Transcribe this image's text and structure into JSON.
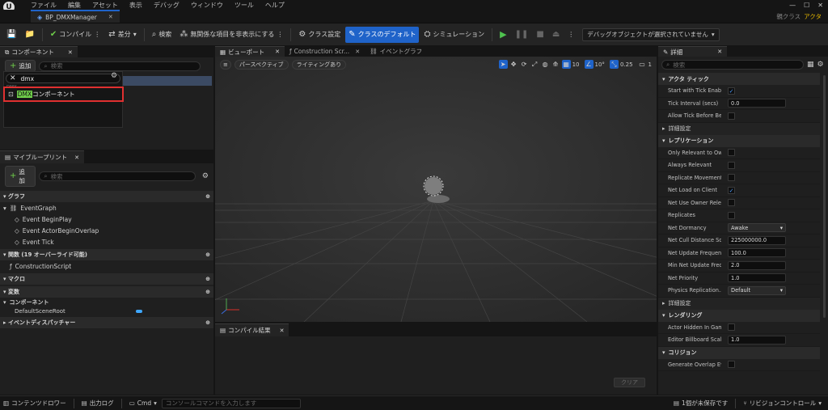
{
  "menubar": {
    "items": [
      "ファイル",
      "編集",
      "アセット",
      "表示",
      "デバッグ",
      "ウィンドウ",
      "ツール",
      "ヘルプ"
    ],
    "parent_class_label": "親クラス",
    "parent_class_value": "アクタ"
  },
  "window": {
    "tab_title": "BP_DMXManager"
  },
  "toolbar": {
    "compile": "コンパイル",
    "diff": "差分",
    "find": "検索",
    "hide_unrelated": "無関係な項目を非表示にする",
    "class_settings": "クラス設定",
    "class_defaults": "クラスのデフォルト",
    "simulation": "シミュレーション",
    "debug_object": "デバッグオブジェクトが選択されていません"
  },
  "components_panel": {
    "tab": "コンポーネント",
    "add": "追加",
    "search_placeholder": "検索",
    "filter_value": "dmx",
    "category": "DMX",
    "result_highlight": "DMX",
    "result_rest": "コンポーネント"
  },
  "blueprint_panel": {
    "tab": "マイブループリント",
    "add": "追加",
    "search_placeholder": "検索",
    "graph_section": "グラフ",
    "event_graph": "EventGraph",
    "events": [
      "Event BeginPlay",
      "Event ActorBeginOverlap",
      "Event Tick"
    ],
    "functions_section": "関数 (19 オーバーライド可能)",
    "construction_script": "ConstructionScript",
    "macros_section": "マクロ",
    "variables_section": "変数",
    "components_group": "コンポーネント",
    "default_scene_root": "DefaultSceneRoot",
    "dispatchers_section": "イベントディスパッチャー"
  },
  "center_tabs": {
    "viewport": "ビューポート",
    "construction": "Construction Scr...",
    "event_graph": "イベントグラフ"
  },
  "viewport": {
    "perspective": "パースペクティブ",
    "lighting": "ライティングあり",
    "grid_snap": "10",
    "rot_snap": "10°",
    "scale_snap": "0.25",
    "camera_speed": "1"
  },
  "compile_results": {
    "tab": "コンパイル結果",
    "clear": "クリア"
  },
  "details": {
    "tab": "詳細",
    "search_placeholder": "検索",
    "sections": {
      "actor_tick": "アクタ ティック",
      "advanced": "詳細設定",
      "replication": "レプリケーション",
      "rendering": "レンダリング",
      "collision": "コリジョン"
    },
    "tick_rows": [
      {
        "name": "Start with Tick Enabl...",
        "type": "check",
        "checked": true
      },
      {
        "name": "Tick Interval (secs)",
        "type": "input",
        "value": "0.0"
      },
      {
        "name": "Allow Tick Before Be...",
        "type": "check",
        "checked": false
      }
    ],
    "replication_rows": [
      {
        "name": "Only Relevant to Ow...",
        "type": "check",
        "checked": false
      },
      {
        "name": "Always Relevant",
        "type": "check",
        "checked": false
      },
      {
        "name": "Replicate Movement",
        "type": "check",
        "checked": false
      },
      {
        "name": "Net Load on Client",
        "type": "check",
        "checked": true
      },
      {
        "name": "Net Use Owner Rele...",
        "type": "check",
        "checked": false
      },
      {
        "name": "Replicates",
        "type": "check",
        "checked": false
      },
      {
        "name": "Net Dormancy",
        "type": "select",
        "value": "Awake"
      },
      {
        "name": "Net Cull Distance Sq...",
        "type": "input",
        "value": "225000000.0"
      },
      {
        "name": "Net Update Frequency",
        "type": "input",
        "value": "100.0"
      },
      {
        "name": "Min Net Update Freq...",
        "type": "input",
        "value": "2.0"
      },
      {
        "name": "Net Priority",
        "type": "input",
        "value": "1.0"
      },
      {
        "name": "Physics Replication...",
        "type": "select",
        "value": "Default"
      }
    ],
    "rendering_rows": [
      {
        "name": "Actor Hidden In Game",
        "type": "check",
        "checked": false
      },
      {
        "name": "Editor Billboard Scale",
        "type": "input",
        "value": "1.0"
      }
    ],
    "collision_rows": [
      {
        "name": "Generate Overlap Ev...",
        "type": "check",
        "checked": false
      }
    ]
  },
  "statusbar": {
    "content_drawer": "コンテンツドロワー",
    "output_log": "出力ログ",
    "cmd": "Cmd",
    "console_placeholder": "コンソールコマンドを入力します",
    "unsaved": "1個が未保存です",
    "revision_control": "リビジョンコントロール"
  },
  "colors": {
    "accent_blue": "#1f63c9",
    "highlight_green": "#6fcf4a",
    "selection_red": "#e03030"
  }
}
